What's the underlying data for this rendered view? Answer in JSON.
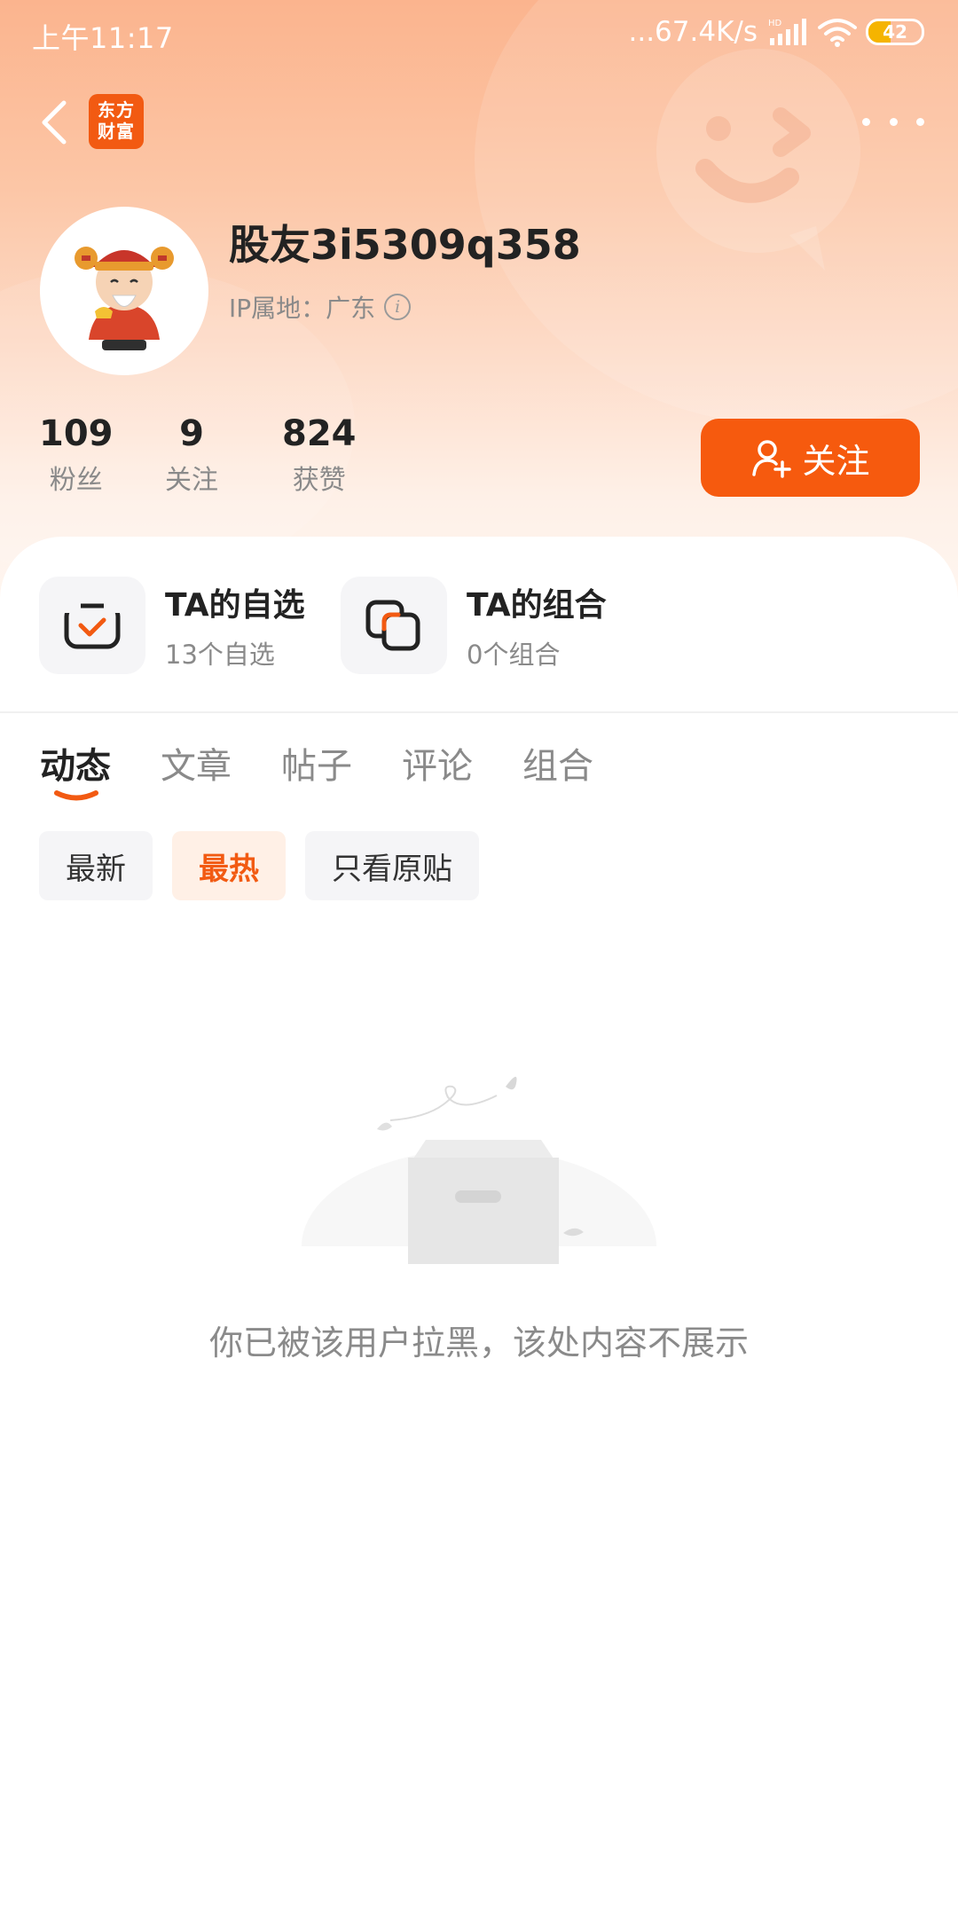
{
  "status_bar": {
    "time": "上午11:17",
    "net_speed": "...67.4K/s",
    "signal_badge": "HD",
    "battery_level": "42",
    "battery_fraction": 0.42
  },
  "nav": {
    "logo_line1": "东方",
    "logo_line2": "财富"
  },
  "profile": {
    "username": "股友3i5309q358",
    "ip_location": "IP属地：广东",
    "info_glyph": "i"
  },
  "stats": [
    {
      "value": "109",
      "label": "粉丝"
    },
    {
      "value": "9",
      "label": "关注"
    },
    {
      "value": "824",
      "label": "获赞"
    }
  ],
  "follow_button": {
    "label": "关注"
  },
  "shortcuts": [
    {
      "title": "TA的自选",
      "subtitle": "13个自选"
    },
    {
      "title": "TA的组合",
      "subtitle": "0个组合"
    }
  ],
  "tabs": [
    {
      "label": "动态",
      "active": true
    },
    {
      "label": "文章"
    },
    {
      "label": "帖子"
    },
    {
      "label": "评论"
    },
    {
      "label": "组合"
    }
  ],
  "filters": [
    {
      "label": "最新"
    },
    {
      "label": "最热",
      "active": true
    },
    {
      "label": "只看原贴"
    }
  ],
  "empty_state": {
    "message": "你已被该用户拉黑，该处内容不展示"
  },
  "colors": {
    "accent": "#f65a0e",
    "header_gradient_top": "#fbb48e",
    "text_primary": "#222222",
    "text_secondary": "#8a8a8a"
  }
}
